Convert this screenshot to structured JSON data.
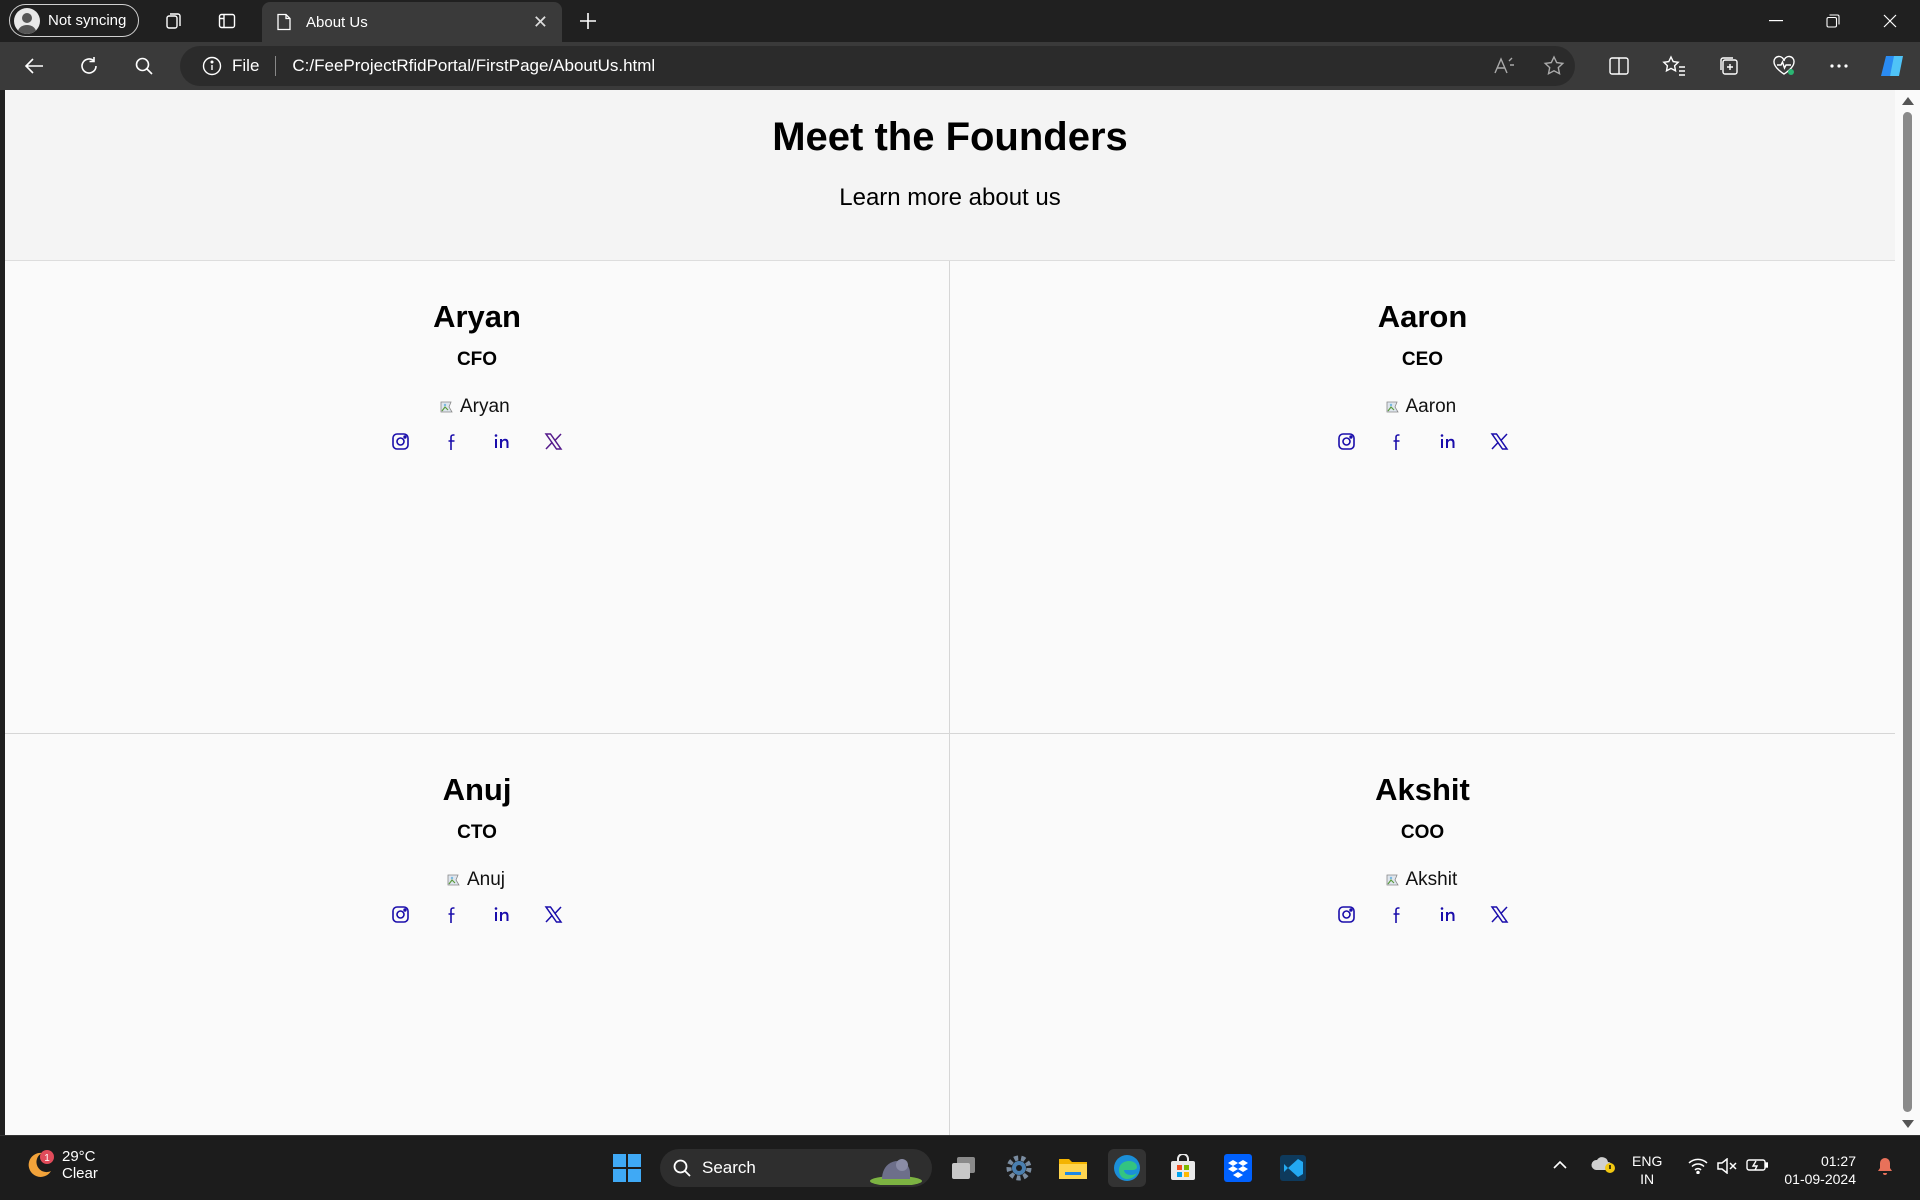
{
  "browser": {
    "profile_label": "Not syncing",
    "tab_title": "About Us",
    "address": {
      "scheme_label": "File",
      "url": "C:/FeeProjectRfidPortal/FirstPage/AboutUs.html"
    }
  },
  "page": {
    "title": "Meet the Founders",
    "subtitle": "Learn more about us",
    "founders": [
      {
        "name": "Aryan",
        "role": "CFO",
        "img_alt": "Aryan"
      },
      {
        "name": "Aaron",
        "role": "CEO",
        "img_alt": "Aaron"
      },
      {
        "name": "Anuj",
        "role": "CTO",
        "img_alt": "Anuj"
      },
      {
        "name": "Akshit",
        "role": "COO",
        "img_alt": "Akshit"
      }
    ],
    "social_icons": [
      "instagram-icon",
      "facebook-icon",
      "linkedin-icon",
      "x-twitter-icon"
    ],
    "link_color": "#1a0dab",
    "visited_link_color": "#551a8b"
  },
  "taskbar": {
    "weather": {
      "temp": "29°C",
      "condition": "Clear",
      "badge": "1"
    },
    "search_label": "Search",
    "language": {
      "line1": "ENG",
      "line2": "IN"
    },
    "clock": {
      "time": "01:27",
      "date": "01-09-2024"
    }
  }
}
